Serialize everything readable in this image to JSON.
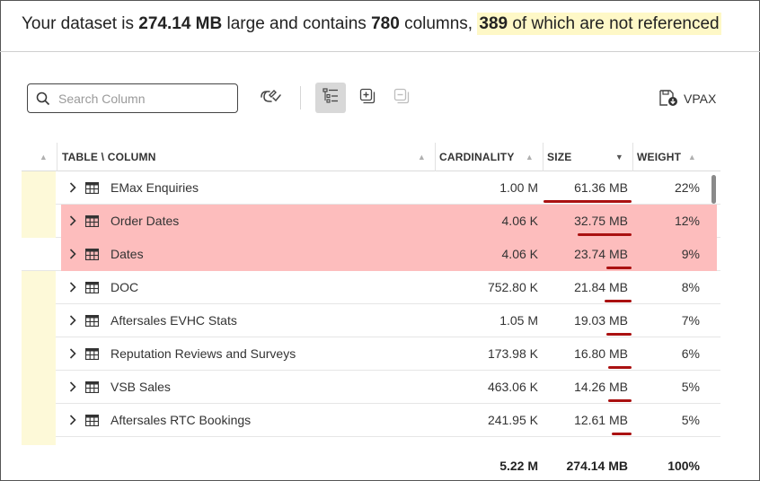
{
  "summary": {
    "prefix": "Your dataset is",
    "size": "274.14 MB",
    "mid": "large and contains",
    "columns": "780",
    "mid2": "columns,",
    "unreferenced": "389",
    "suffix": "of which are not referenced"
  },
  "toolbar": {
    "search_placeholder": "Search Column",
    "search_value": "",
    "vpax_label": "VPAX",
    "icons": [
      "search-icon",
      "unlink-icon",
      "tree-view-icon",
      "expand-all-icon",
      "collapse-all-icon",
      "save-vpax-icon"
    ]
  },
  "table": {
    "headers": {
      "name": "TABLE \\ COLUMN",
      "cardinality": "CARDINALITY",
      "size": "SIZE",
      "weight": "WEIGHT"
    },
    "sort": {
      "column": "size",
      "direction": "desc"
    },
    "rows": [
      {
        "name": "EMax Enquiries",
        "cardinality": "1.00 M",
        "size": "61.36 MB",
        "weight": "22%",
        "highlighted": false,
        "unreferenced_marker": true
      },
      {
        "name": "Order Dates",
        "cardinality": "4.06 K",
        "size": "32.75 MB",
        "weight": "12%",
        "highlighted": true,
        "unreferenced_marker": true
      },
      {
        "name": "Dates",
        "cardinality": "4.06 K",
        "size": "23.74 MB",
        "weight": "9%",
        "highlighted": true,
        "unreferenced_marker": false
      },
      {
        "name": "DOC",
        "cardinality": "752.80 K",
        "size": "21.84 MB",
        "weight": "8%",
        "highlighted": false,
        "unreferenced_marker": true
      },
      {
        "name": "Aftersales EVHC Stats",
        "cardinality": "1.05 M",
        "size": "19.03 MB",
        "weight": "7%",
        "highlighted": false,
        "unreferenced_marker": true
      },
      {
        "name": "Reputation Reviews and Surveys",
        "cardinality": "173.98 K",
        "size": "16.80 MB",
        "weight": "6%",
        "highlighted": false,
        "unreferenced_marker": true
      },
      {
        "name": "VSB Sales",
        "cardinality": "463.06 K",
        "size": "14.26 MB",
        "weight": "5%",
        "highlighted": false,
        "unreferenced_marker": true
      },
      {
        "name": "Aftersales RTC Bookings",
        "cardinality": "241.95 K",
        "size": "12.61 MB",
        "weight": "5%",
        "highlighted": false,
        "unreferenced_marker": true
      }
    ],
    "totals": {
      "cardinality": "5.22 M",
      "size": "274.14 MB",
      "weight": "100%"
    }
  },
  "colors": {
    "highlight_row": "#fdbdbd",
    "unreferenced_gutter": "#fdf9d8",
    "underline": "#aa1111"
  }
}
